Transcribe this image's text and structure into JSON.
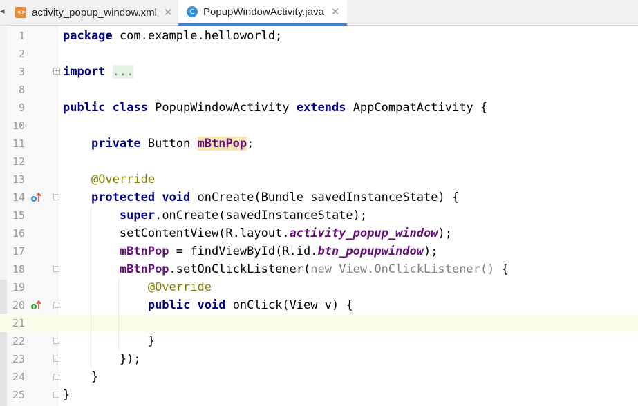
{
  "tabs": [
    {
      "label": "activity_popup_window.xml",
      "icon": "xml-file-icon",
      "active": false
    },
    {
      "label": "PopupWindowActivity.java",
      "icon": "java-class-icon",
      "active": true
    }
  ],
  "editor": {
    "current_line": "21",
    "lines": [
      {
        "n": "1"
      },
      {
        "n": "2"
      },
      {
        "n": "3"
      },
      {
        "n": "8"
      },
      {
        "n": "9"
      },
      {
        "n": "10"
      },
      {
        "n": "11"
      },
      {
        "n": "12"
      },
      {
        "n": "13"
      },
      {
        "n": "14"
      },
      {
        "n": "15"
      },
      {
        "n": "16"
      },
      {
        "n": "17"
      },
      {
        "n": "18"
      },
      {
        "n": "19"
      },
      {
        "n": "20"
      },
      {
        "n": "21"
      },
      {
        "n": "22"
      },
      {
        "n": "23"
      },
      {
        "n": "24"
      },
      {
        "n": "25"
      }
    ]
  },
  "code": {
    "l1": {
      "kw": "package",
      "rest": " com.example.helloworld;"
    },
    "l3": {
      "kw": "import",
      "folded": "..."
    },
    "l9": {
      "kw1": "public",
      "kw2": "class",
      "name": " PopupWindowActivity ",
      "kw3": "extends",
      "rest": " AppCompatActivity {"
    },
    "l11": {
      "kw": "private",
      "type": " Button ",
      "field": "mBtnPop",
      "rest": ";"
    },
    "l13": {
      "ann": "@Override"
    },
    "l14": {
      "kw1": "protected",
      "kw2": "void",
      "rest": " onCreate(Bundle savedInstanceState) {"
    },
    "l15": {
      "kw": "super",
      "rest": ".onCreate(savedInstanceState);"
    },
    "l16": {
      "pre": "setContentView(R.layout.",
      "ital": "activity_popup_window",
      "post": ");"
    },
    "l17": {
      "field": "mBtnPop",
      "pre": " = findViewById(R.id.",
      "ital": "btn_popupwindow",
      "post": ");"
    },
    "l18": {
      "field": "mBtnPop",
      "pre": ".setOnClickListener(",
      "kw": "new",
      "dim": " View.OnClickListener()",
      "post": " {"
    },
    "l19": {
      "ann": "@Override"
    },
    "l20": {
      "kw1": "public",
      "kw2": "void",
      "rest": " onClick(View v) {"
    },
    "l22": {
      "text": "}"
    },
    "l23": {
      "text": "});"
    },
    "l24": {
      "text": "}"
    },
    "l25": {
      "text": "}"
    }
  },
  "colors": {
    "keyword": "#000080",
    "annotation": "#808000",
    "field": "#660e7a",
    "current_line": "#fcfcea",
    "tab_underline": "#4083c9"
  }
}
